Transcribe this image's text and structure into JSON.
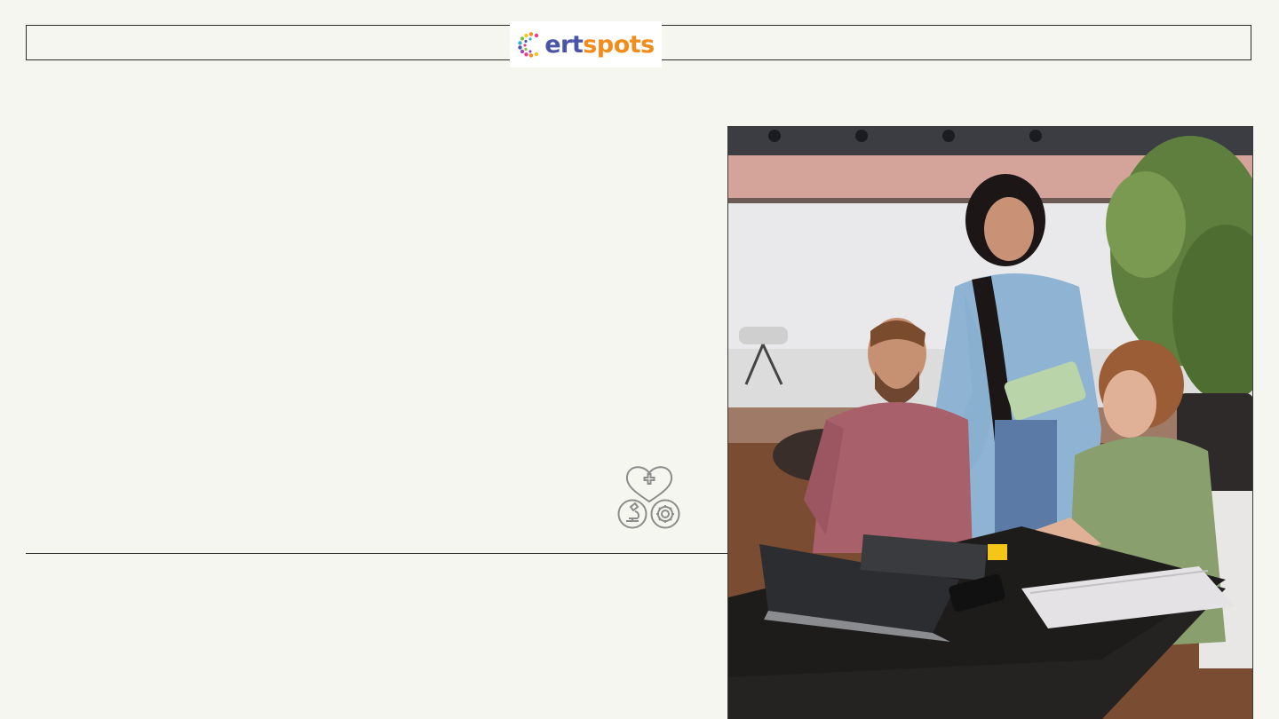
{
  "brand": {
    "logo_text_ert": "ert",
    "logo_text_spots": "spots",
    "logo_icon": "certspots-c-dots-icon"
  },
  "icons": {
    "cluster": [
      "heart-plus-icon",
      "microscope-icon",
      "gear-icon"
    ],
    "cluster_color": "#8c8c8c"
  },
  "colors": {
    "background": "#f6f6f0",
    "line": "#2b2b2b",
    "brand_blue": "#4b55a8",
    "brand_orange": "#f28c1a"
  },
  "photo": {
    "alt_icon": "team-meeting-photo"
  }
}
